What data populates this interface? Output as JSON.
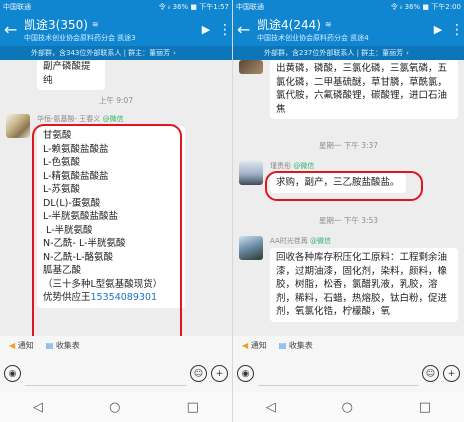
{
  "left": {
    "status": {
      "carrier": "中国联通",
      "right": "令 ᵢₗ 36% ■ 下午1:57"
    },
    "title": "凯途3(350)",
    "subtitle": "中国技术创业协会原料药分会 凯途3",
    "info": "外部群，含343位外部联系人 | 群主：董丽芳",
    "partial_text": "副产磷酸提纯",
    "time1": "上午 9:07",
    "sender": {
      "name": "华恒-氨基酸- 王春义",
      "tag": "@微信"
    },
    "lines": [
      "甘氨酸",
      "L-赖氨酸盐酸盐",
      "L-色氨酸",
      "L-精氨酸盐酸盐",
      "L-苏氨酸",
      "DL(L)-蛋氨酸",
      "L-半胱氨酸盐酸盐",
      "L-半胱氨酸",
      "N-乙酰- L-半胱氨酸",
      "N-乙酰-L-酪氨酸",
      "胍基乙酸",
      "（三十多种L型氨基酸现货）"
    ],
    "supplier": "优势供应王",
    "phone": "15354089301",
    "toolbar": {
      "notice": "通知",
      "collect": "收集表"
    }
  },
  "right": {
    "status": {
      "carrier": "中国联通",
      "right": "令 ᵢₗ 36% ■ 下午2:00"
    },
    "title": "凯途4(244)",
    "subtitle": "中国技术创业协会原料药分会 凯途4",
    "info": "外部群，含237位外部联系人 | 群主：董丽芳",
    "top_bubble": "出黄磷，磷酸，三氯化磷，三氯氧磷，五氯化磷，二甲基硫醚，草甘膦，草酰氯，氯代胺，六氟磷酸锂，碳酸锂，进口石油焦",
    "time1": "星期一 下午 3:37",
    "sender1": {
      "name": "瑾贵彤",
      "tag": "@微信"
    },
    "bubble1": "求购，副产，三乙胺盐酸盐。",
    "time2": "星期一 下午 3:53",
    "sender2": {
      "name": "AA时光荏苒",
      "tag": "@微信"
    },
    "bubble2": "回收各种库存积压化工原料：工程剩余油漆，过期油漆，固化剂，染料，颜料，橡胶，树脂，松香，氯醋乳液，乳胶，溶剂，稀料，石蜡，热熔胶，钛白粉，促进剂，氧氯化锆，柠檬酸，氧",
    "toolbar": {
      "notice": "通知",
      "collect": "收集表"
    }
  },
  "icons": {
    "back": "←",
    "video": "▶",
    "more": "⋮",
    "voice": "◉",
    "emoji": "☺",
    "plus": "+",
    "nav_back": "◁",
    "nav_home": "○",
    "nav_recent": "□"
  },
  "colors": {
    "header": "#0f86cf",
    "annotation": "#e2151d",
    "wechat_tag": "#2eb46c"
  }
}
